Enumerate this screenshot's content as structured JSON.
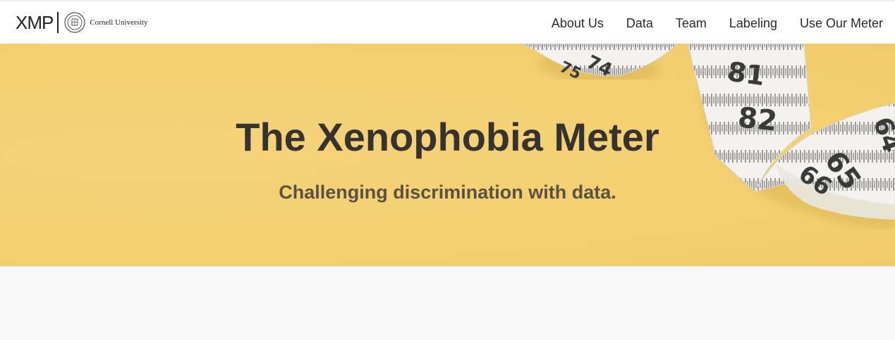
{
  "brand": {
    "logo_text": "XMP",
    "institution": "Cornell University"
  },
  "nav": {
    "items": [
      {
        "label": "About Us"
      },
      {
        "label": "Data"
      },
      {
        "label": "Team"
      },
      {
        "label": "Labeling"
      },
      {
        "label": "Use Our Meter"
      }
    ]
  },
  "hero": {
    "title": "The Xenophobia Meter",
    "subtitle": "Challenging discrimination with data.",
    "background_color": "#f7d679",
    "tape_numbers": [
      "74",
      "75",
      "81",
      "82",
      "65",
      "66",
      "64"
    ]
  },
  "colors": {
    "title": "#353230",
    "subtitle": "#5b5140"
  }
}
